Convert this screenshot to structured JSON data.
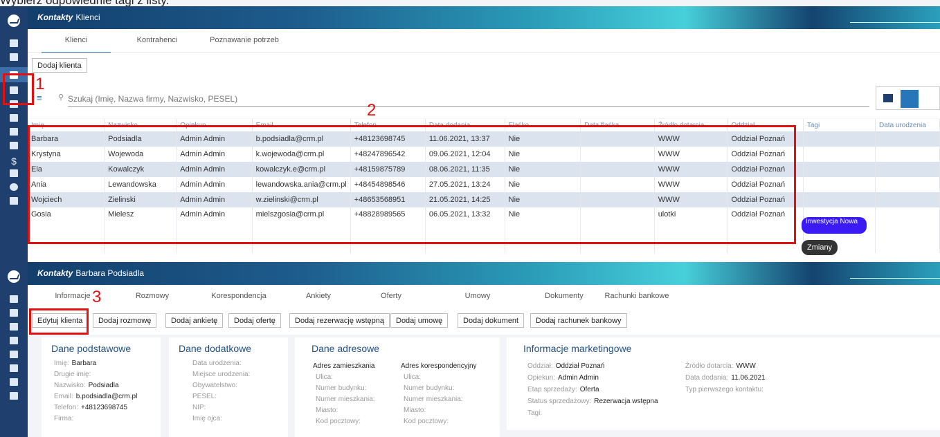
{
  "caption": "Wybierz odpowiednie tagi z listy.",
  "top": {
    "module": "Kontakty",
    "title": "Klienci",
    "tabs": [
      "Klienci",
      "Kontrahenci",
      "Poznawanie potrzeb"
    ],
    "add_button": "Dodaj klienta",
    "search_placeholder": "Szukaj (Imię, Nazwa firmy, Nazwisko, PESEL)",
    "columns": [
      "Imię",
      "Nazwisko",
      "Opiekun",
      "Email",
      "Telefon",
      "Data dodania",
      "Flaśko",
      "Data flaśka",
      "Źródło dotarcia",
      "Oddział",
      "Tagi",
      "Data urodzenia"
    ],
    "rows": [
      {
        "imie": "Barbara",
        "nazwisko": "Podsiadla",
        "opiekun": "Admin Admin",
        "email": "b.podsiadla@crm.pl",
        "telefon": "+48123698745",
        "data": "11.06.2021, 13:37",
        "flag": "Nie",
        "zrodlo": "WWW",
        "oddzial": "Oddział Poznań"
      },
      {
        "imie": "Krystyna",
        "nazwisko": "Wojewoda",
        "opiekun": "Admin Admin",
        "email": "k.wojewoda@crm.pl",
        "telefon": "+48247896542",
        "data": "09.06.2021, 12:04",
        "flag": "Nie",
        "zrodlo": "WWW",
        "oddzial": "Oddział Poznań"
      },
      {
        "imie": "Ela",
        "nazwisko": "Kowalczyk",
        "opiekun": "Admin Admin",
        "email": "kowalczyk.e@crm.pl",
        "telefon": "+48159875789",
        "data": "08.06.2021, 11:35",
        "flag": "Nie",
        "zrodlo": "WWW",
        "oddzial": "Oddział Poznań"
      },
      {
        "imie": "Ania",
        "nazwisko": "Lewandowska",
        "opiekun": "Admin Admin",
        "email": "lewandowska.ania@crm.pl",
        "telefon": "+48454898546",
        "data": "27.05.2021, 13:24",
        "flag": "Nie",
        "zrodlo": "WWW",
        "oddzial": "Oddział Poznań"
      },
      {
        "imie": "Wojciech",
        "nazwisko": "Zielinski",
        "opiekun": "Admin Admin",
        "email": "w.zielinski@crm.pl",
        "telefon": "+48653568951",
        "data": "21.05.2021, 14:25",
        "flag": "Nie",
        "zrodlo": "WWW",
        "oddzial": "Oddział Poznań"
      },
      {
        "imie": "Gosia",
        "nazwisko": "Mielesz",
        "opiekun": "Admin Admin",
        "email": "mielszgosia@crm.pl",
        "telefon": "+48828989565",
        "data": "06.05.2021, 13:32",
        "flag": "Nie",
        "zrodlo": "ulotki",
        "oddzial": "Oddział Poznań"
      }
    ],
    "tags": [
      {
        "label": "Inwestycja Nowa",
        "color": "#3b1bf5"
      },
      {
        "label": "Zmiany",
        "color": "#333333"
      }
    ]
  },
  "annotations": [
    "1",
    "2",
    "3"
  ],
  "bottom": {
    "module": "Kontakty",
    "title": "Barbara Podsiadla",
    "tabs": [
      "Informacje",
      "Rozmowy",
      "Korespondencja",
      "Ankiety",
      "Oferty",
      "Umowy",
      "Dokumenty",
      "Rachunki bankowe"
    ],
    "buttons": [
      "Edytuj klienta",
      "Dodaj rozmowę",
      "Dodaj ankietę",
      "Dodaj ofertę",
      "Dodaj rezerwację wstępną",
      "Dodaj umowę",
      "Dodaj dokument",
      "Dodaj rachunek bankowy"
    ],
    "podstawowe": {
      "title": "Dane podstawowe",
      "rows": [
        [
          "Imię:",
          "Barbara"
        ],
        [
          "Drugie imię:",
          ""
        ],
        [
          "Nazwisko:",
          "Podsiadla"
        ],
        [
          "Email:",
          "b.podsiadla@crm.pl"
        ],
        [
          "Telefon:",
          "+48123698745"
        ],
        [
          "Firma:",
          ""
        ]
      ]
    },
    "dodatkowe": {
      "title": "Dane dodatkowe",
      "rows": [
        "Data urodzenia:",
        "Miejsce urodzenia:",
        "Obywatelstwo:",
        "PESEL:",
        "NIP:",
        "Imię ojca:"
      ]
    },
    "adresowe": {
      "title": "Dane adresowe",
      "col1": "Adres zamieszkania",
      "col2": "Adres korespondencyjny",
      "rows": [
        "Ulica:",
        "Numer budynku:",
        "Numer mieszkania:",
        "Miasto:",
        "Kod pocztowy:"
      ]
    },
    "marketing": {
      "title": "Informacje marketingowe",
      "left": [
        [
          "Oddział:",
          "Oddział Poznań"
        ],
        [
          "Opiekun:",
          "Admin Admin"
        ],
        [
          "Etap sprzedaży:",
          "Oferta"
        ],
        [
          "Status sprzedażowy:",
          "Rezerwacja wstępna"
        ],
        [
          "Tagi:",
          ""
        ]
      ],
      "right": [
        [
          "Źródło dotarcia:",
          "WWW"
        ],
        [
          "Data dodania:",
          "11.06.2021"
        ],
        [
          "Typ pierwszego kontaktu:",
          ""
        ]
      ]
    }
  }
}
